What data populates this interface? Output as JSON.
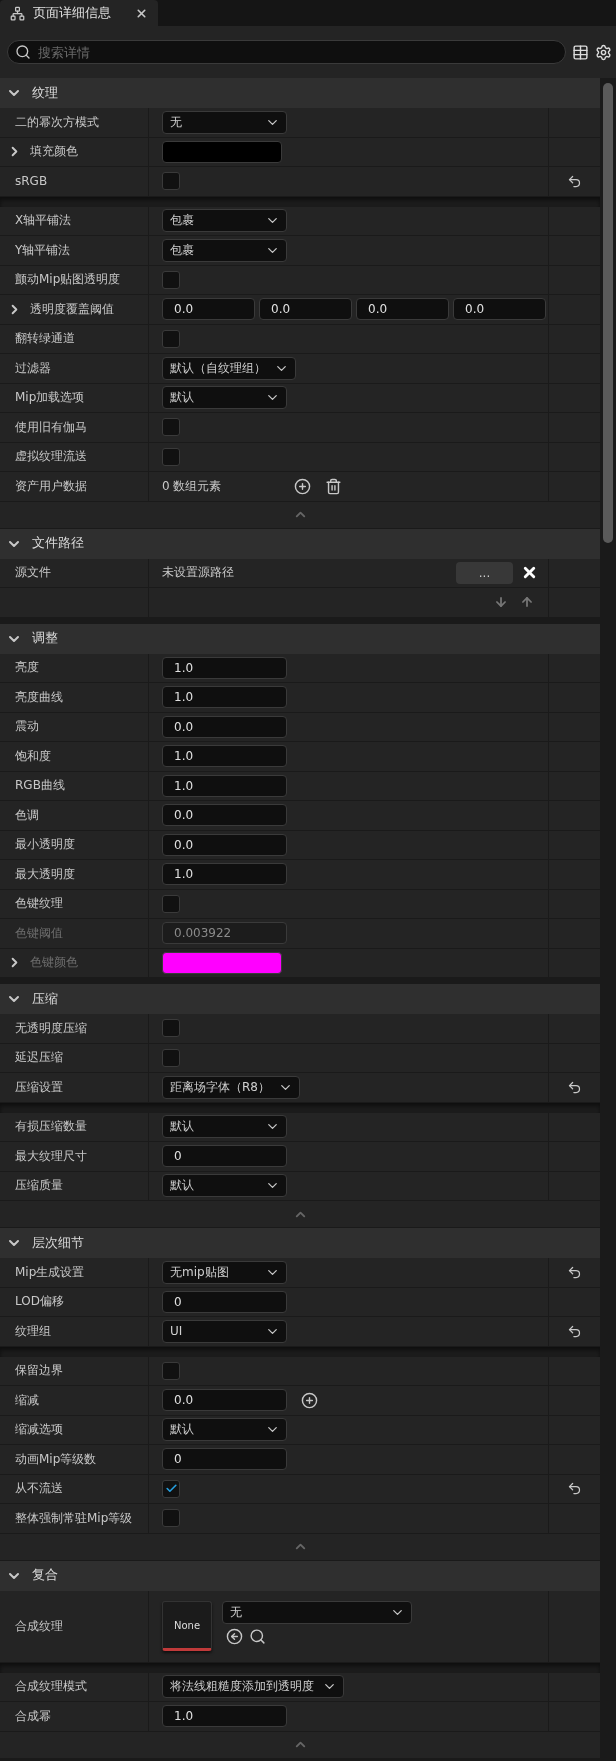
{
  "tab": {
    "title": "页面详细信息"
  },
  "search": {
    "placeholder": "搜索详情"
  },
  "sections": [
    {
      "title": "纹理",
      "expanded": true,
      "advanced_expanded": true,
      "rows": [
        {
          "label": "二的幂次方模式",
          "kind": "dropdown",
          "value": "无",
          "expandable": false,
          "disabled": false,
          "reset": false
        },
        {
          "label": "填充颜色",
          "kind": "color",
          "color": "#000000",
          "expandable": true,
          "disabled": false,
          "reset": false
        },
        {
          "label": "sRGB",
          "kind": "checkbox",
          "checked": false,
          "expandable": false,
          "disabled": false,
          "reset": true
        }
      ],
      "advanced_rows": [
        {
          "label": "X轴平铺法",
          "kind": "dropdown",
          "value": "包裹",
          "expandable": false,
          "disabled": false,
          "reset": false
        },
        {
          "label": "Y轴平铺法",
          "kind": "dropdown",
          "value": "包裹",
          "expandable": false,
          "disabled": false,
          "reset": false
        },
        {
          "label": "颤动Mip贴图透明度",
          "kind": "checkbox",
          "checked": false,
          "expandable": false,
          "disabled": false,
          "reset": false
        },
        {
          "label": "透明度覆盖阈值",
          "kind": "vector",
          "values": [
            "0.0",
            "0.0",
            "0.0",
            "0.0"
          ],
          "expandable": true,
          "disabled": false,
          "reset": false
        },
        {
          "label": "翻转绿通道",
          "kind": "checkbox",
          "checked": false,
          "expandable": false,
          "disabled": false,
          "reset": false
        },
        {
          "label": "过滤器",
          "kind": "dropdown",
          "value": "默认（自纹理组）",
          "expandable": false,
          "disabled": false,
          "reset": false
        },
        {
          "label": "Mip加载选项",
          "kind": "dropdown",
          "value": "默认",
          "expandable": false,
          "disabled": false,
          "reset": false
        },
        {
          "label": "使用旧有伽马",
          "kind": "checkbox",
          "checked": false,
          "expandable": false,
          "disabled": false,
          "reset": false
        },
        {
          "label": "虚拟纹理流送",
          "kind": "checkbox",
          "checked": false,
          "expandable": false,
          "disabled": false,
          "reset": false
        },
        {
          "label": "资产用户数据",
          "kind": "array",
          "value": "0 数组元素",
          "expandable": false,
          "disabled": false,
          "reset": false
        }
      ]
    },
    {
      "title": "文件路径",
      "expanded": true,
      "rows": [
        {
          "label": "源文件",
          "kind": "path",
          "value": "未设置源路径",
          "button": "...",
          "expandable": false,
          "disabled": false,
          "reset": false
        },
        {
          "kind": "reorder",
          "expandable": false,
          "reset": false
        }
      ]
    },
    {
      "title": "调整",
      "expanded": true,
      "rows": [
        {
          "label": "亮度",
          "kind": "number",
          "value": "1.0",
          "expandable": false,
          "disabled": false,
          "reset": false
        },
        {
          "label": "亮度曲线",
          "kind": "number",
          "value": "1.0",
          "expandable": false,
          "disabled": false,
          "reset": false
        },
        {
          "label": "震动",
          "kind": "number",
          "value": "0.0",
          "expandable": false,
          "disabled": false,
          "reset": false
        },
        {
          "label": "饱和度",
          "kind": "number",
          "value": "1.0",
          "expandable": false,
          "disabled": false,
          "reset": false
        },
        {
          "label": "RGB曲线",
          "kind": "number",
          "value": "1.0",
          "expandable": false,
          "disabled": false,
          "reset": false
        },
        {
          "label": "色调",
          "kind": "number",
          "value": "0.0",
          "expandable": false,
          "disabled": false,
          "reset": false
        },
        {
          "label": "最小透明度",
          "kind": "number",
          "value": "0.0",
          "expandable": false,
          "disabled": false,
          "reset": false
        },
        {
          "label": "最大透明度",
          "kind": "number",
          "value": "1.0",
          "expandable": false,
          "disabled": false,
          "reset": false
        },
        {
          "label": "色键纹理",
          "kind": "checkbox",
          "checked": false,
          "expandable": false,
          "disabled": false,
          "reset": false
        },
        {
          "label": "色键阈值",
          "kind": "number",
          "value": "0.003922",
          "expandable": false,
          "disabled": true,
          "reset": false
        },
        {
          "label": "色键颜色",
          "kind": "color",
          "color": "#ff00ff",
          "expandable": true,
          "disabled": true,
          "reset": false
        }
      ]
    },
    {
      "title": "压缩",
      "expanded": true,
      "advanced_expanded": true,
      "rows": [
        {
          "label": "无透明度压缩",
          "kind": "checkbox",
          "checked": false,
          "expandable": false,
          "disabled": false,
          "reset": false
        },
        {
          "label": "延迟压缩",
          "kind": "checkbox",
          "checked": false,
          "expandable": false,
          "disabled": false,
          "reset": false
        },
        {
          "label": "压缩设置",
          "kind": "dropdown",
          "value": "距离场字体（R8）",
          "expandable": false,
          "disabled": false,
          "reset": true
        }
      ],
      "advanced_rows": [
        {
          "label": "有损压缩数量",
          "kind": "dropdown",
          "value": "默认",
          "expandable": false,
          "disabled": false,
          "reset": false
        },
        {
          "label": "最大纹理尺寸",
          "kind": "number",
          "value": "0",
          "expandable": false,
          "disabled": false,
          "reset": false
        },
        {
          "label": "压缩质量",
          "kind": "dropdown",
          "value": "默认",
          "expandable": false,
          "disabled": false,
          "reset": false
        }
      ]
    },
    {
      "title": "层次细节",
      "expanded": true,
      "advanced_expanded": true,
      "rows": [
        {
          "label": "Mip生成设置",
          "kind": "dropdown",
          "value": "无mip贴图",
          "expandable": false,
          "disabled": false,
          "reset": true
        },
        {
          "label": "LOD偏移",
          "kind": "number",
          "value": "0",
          "expandable": false,
          "disabled": false,
          "reset": false
        },
        {
          "label": "纹理组",
          "kind": "dropdown",
          "value": "UI",
          "expandable": false,
          "disabled": false,
          "reset": true
        }
      ],
      "advanced_rows": [
        {
          "label": "保留边界",
          "kind": "checkbox",
          "checked": false,
          "expandable": false,
          "disabled": false,
          "reset": false
        },
        {
          "label": "缩减",
          "kind": "number_add",
          "value": "0.0",
          "expandable": false,
          "disabled": false,
          "reset": false
        },
        {
          "label": "缩减选项",
          "kind": "dropdown",
          "value": "默认",
          "expandable": false,
          "disabled": false,
          "reset": false
        },
        {
          "label": "动画Mip等级数",
          "kind": "number",
          "value": "0",
          "expandable": false,
          "disabled": false,
          "reset": false
        },
        {
          "label": "从不流送",
          "kind": "checkbox",
          "checked": true,
          "expandable": false,
          "disabled": false,
          "reset": true
        },
        {
          "label": "整体强制常驻Mip等级",
          "kind": "checkbox",
          "checked": false,
          "expandable": false,
          "disabled": false,
          "reset": false
        }
      ]
    },
    {
      "title": "复合",
      "expanded": true,
      "advanced_expanded": true,
      "rows": [
        {
          "label": "合成纹理",
          "kind": "texture",
          "thumbnail": "None",
          "value": "无",
          "expandable": false,
          "disabled": false,
          "reset": false
        }
      ],
      "advanced_rows": [
        {
          "label": "合成纹理模式",
          "kind": "dropdown",
          "value": "将法线粗糙度添加到透明度",
          "expandable": false,
          "disabled": false,
          "reset": false
        },
        {
          "label": "合成幂",
          "kind": "number",
          "value": "1.0",
          "expandable": false,
          "disabled": false,
          "reset": false
        }
      ]
    }
  ]
}
